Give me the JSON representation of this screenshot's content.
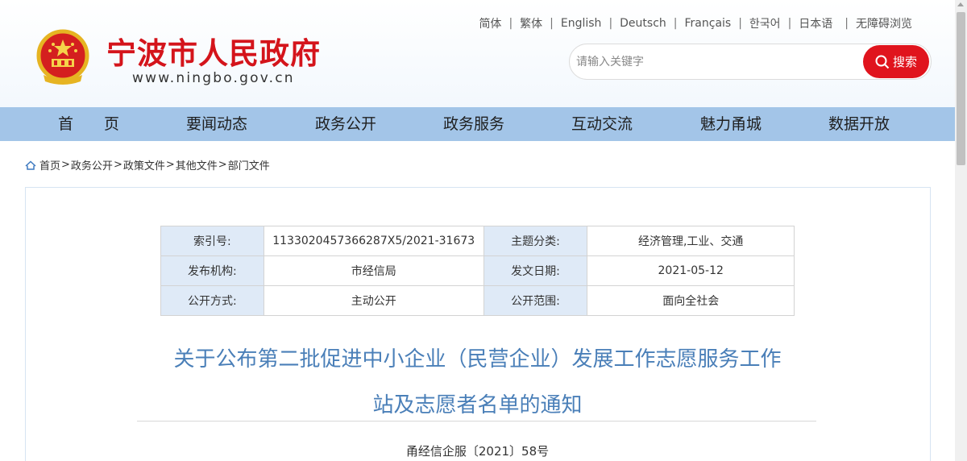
{
  "header": {
    "site_title": "宁波市人民政府",
    "site_url": "www.ningbo.gov.cn",
    "emblem_icon": "national-emblem-icon",
    "title_color": "#d4141b"
  },
  "languages": [
    "简体",
    "繁体",
    "English",
    "Deutsch",
    "Français",
    "한국어",
    "日本语",
    "无障碍浏览"
  ],
  "search": {
    "placeholder": "请输入关键字",
    "button_label": "搜索",
    "button_color": "#e0141d"
  },
  "nav": {
    "background": "#a3c5e8",
    "items": [
      "首　　页",
      "要闻动态",
      "政务公开",
      "政务服务",
      "互动交流",
      "魅力甬城",
      "数据开放"
    ]
  },
  "breadcrumb": {
    "home": "首页",
    "items": [
      "政务公开",
      "政策文件",
      "其他文件",
      "部门文件"
    ]
  },
  "meta": {
    "index_label": "索引号:",
    "index_value": "1133020457366287X5/2021-31673",
    "topic_label": "主题分类:",
    "topic_value": "经济管理,工业、交通",
    "publisher_label": "发布机构:",
    "publisher_value": "市经信局",
    "date_label": "发文日期:",
    "date_value": "2021-05-12",
    "mode_label": "公开方式:",
    "mode_value": "主动公开",
    "scope_label": "公开范围:",
    "scope_value": "面向全社会"
  },
  "document": {
    "title_line1": "关于公布第二批促进中小企业（民营企业）发展工作志愿服务工作",
    "title_line2": "站及志愿者名单的通知",
    "number": "甬经信企服〔2021〕58号",
    "title_color": "#4a7fb8"
  }
}
